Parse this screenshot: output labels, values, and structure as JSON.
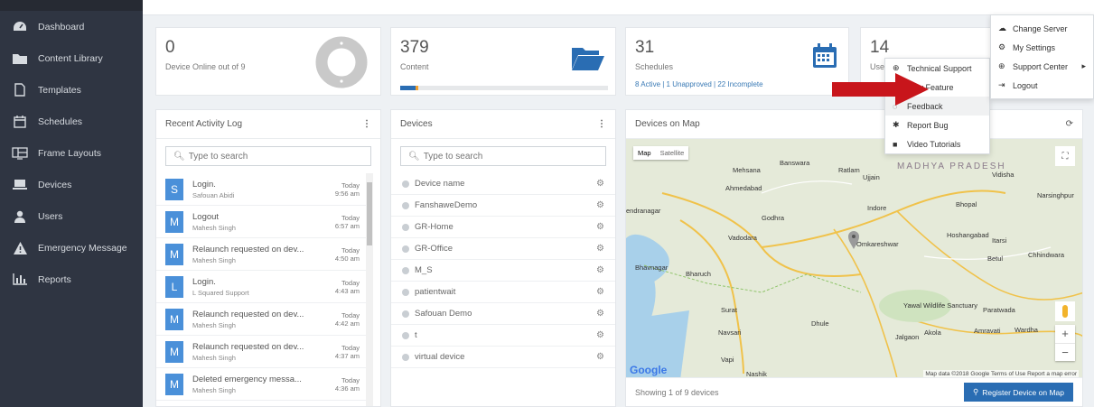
{
  "sidebar": {
    "items": [
      {
        "label": "Dashboard",
        "icon": "dashboard-icon"
      },
      {
        "label": "Content Library",
        "icon": "folder-icon"
      },
      {
        "label": "Templates",
        "icon": "file-icon"
      },
      {
        "label": "Schedules",
        "icon": "calendar-icon"
      },
      {
        "label": "Frame Layouts",
        "icon": "layout-icon"
      },
      {
        "label": "Devices",
        "icon": "laptop-icon"
      },
      {
        "label": "Users",
        "icon": "user-icon"
      },
      {
        "label": "Emergency Message",
        "icon": "warning-icon"
      },
      {
        "label": "Reports",
        "icon": "chart-icon"
      }
    ]
  },
  "stats": {
    "devices": {
      "value": "0",
      "label": "Device Online out of 9"
    },
    "content": {
      "value": "379",
      "label": "Content"
    },
    "schedules": {
      "value": "31",
      "label": "Schedules",
      "sub_active": "8 Active",
      "sub_unapproved": "1 Unapproved",
      "sub_incomplete": "22 Incomplete"
    },
    "users": {
      "value": "14",
      "label": "Use"
    }
  },
  "activity": {
    "title": "Recent Activity Log",
    "search_placeholder": "Type to search",
    "items": [
      {
        "initial": "S",
        "title": "Login.",
        "user": "Safouan Abidi",
        "day": "Today",
        "time": "9:56 am"
      },
      {
        "initial": "M",
        "title": "Logout",
        "user": "Mahesh Singh",
        "day": "Today",
        "time": "6:57 am"
      },
      {
        "initial": "M",
        "title": "Relaunch requested on dev...",
        "user": "Mahesh Singh",
        "day": "Today",
        "time": "4:50 am"
      },
      {
        "initial": "L",
        "title": "Login.",
        "user": "L Squared Support",
        "day": "Today",
        "time": "4:43 am"
      },
      {
        "initial": "M",
        "title": "Relaunch requested on dev...",
        "user": "Mahesh Singh",
        "day": "Today",
        "time": "4:42 am"
      },
      {
        "initial": "M",
        "title": "Relaunch requested on dev...",
        "user": "Mahesh Singh",
        "day": "Today",
        "time": "4:37 am"
      },
      {
        "initial": "M",
        "title": "Deleted emergency messa...",
        "user": "Mahesh Singh",
        "day": "Today",
        "time": "4:36 am"
      }
    ]
  },
  "devices": {
    "title": "Devices",
    "search_placeholder": "Type to search",
    "items": [
      "Device name",
      "FanshaweDemo",
      "GR-Home",
      "GR-Office",
      "M_S",
      "patientwait",
      "Safouan Demo",
      "t",
      "virtual device"
    ]
  },
  "map": {
    "title": "Devices on Map",
    "tab_map": "Map",
    "tab_satellite": "Satellite",
    "footer": "Showing 1 of 9 devices",
    "register_label": "Register Device on Map",
    "google": "Google",
    "attribution": "Map data ©2018 Google   Terms of Use   Report a map error",
    "places": [
      "Mehsana",
      "Ahmedabad",
      "Vadodara",
      "Bhavnagar",
      "Bharuch",
      "Surat",
      "Navsari",
      "Vapi",
      "Nashik",
      "Banswara",
      "Ratlam",
      "Ujjain",
      "Indore",
      "Bhopal",
      "Vidisha",
      "Hoshangabad",
      "Itarsi",
      "Betul",
      "Chhindwara",
      "Jalgaon",
      "Dhule",
      "Akola",
      "Amravati",
      "Wardha",
      "Paratwada",
      "Godhra",
      "Omkareshwar",
      "Narsinghpur",
      "MADHYA PRADESH",
      "Yawal Wildlife Sanctuary",
      "endranagar"
    ]
  },
  "support_menu": {
    "items": [
      {
        "label": "Technical Support",
        "icon": "lifebuoy-icon"
      },
      {
        "label": "New Feature",
        "icon": "star-icon"
      },
      {
        "label": "Feedback",
        "icon": "comment-icon"
      },
      {
        "label": "Report Bug",
        "icon": "bug-icon"
      },
      {
        "label": "Video Tutorials",
        "icon": "video-icon"
      }
    ]
  },
  "user_menu": {
    "items": [
      {
        "label": "Change Server",
        "icon": "cloud-icon"
      },
      {
        "label": "My Settings",
        "icon": "cog-icon"
      },
      {
        "label": "Support Center",
        "icon": "lifebuoy-icon"
      },
      {
        "label": "Logout",
        "icon": "logout-icon"
      }
    ]
  },
  "colors": {
    "accent": "#2a6db3",
    "sidebar": "#2f3542",
    "arrow": "#c8151b"
  }
}
